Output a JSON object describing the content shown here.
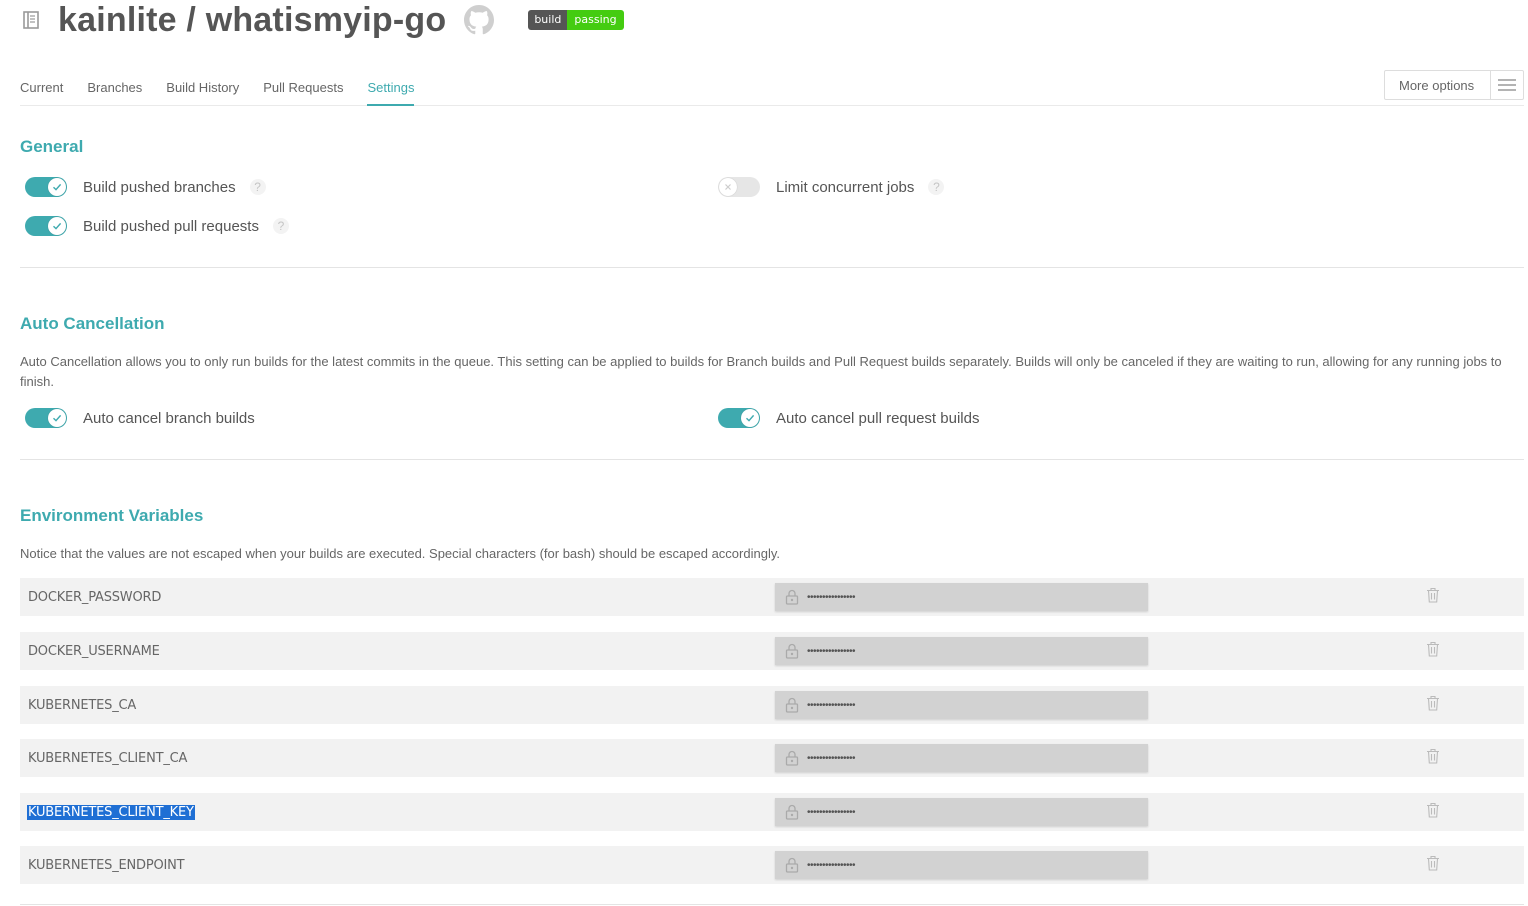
{
  "header": {
    "repo_title": "kainlite / whatismyip-go",
    "badge_left": "build",
    "badge_right": "passing",
    "repo_icon": "repo-book-icon",
    "github_icon": "github-octocat-icon"
  },
  "tabs": [
    {
      "label": "Current",
      "active": false
    },
    {
      "label": "Branches",
      "active": false
    },
    {
      "label": "Build History",
      "active": false
    },
    {
      "label": "Pull Requests",
      "active": false
    },
    {
      "label": "Settings",
      "active": true
    }
  ],
  "more_options": {
    "label": "More options",
    "icon": "hamburger-menu-icon"
  },
  "general": {
    "title": "General",
    "build_pushed_branches": {
      "label": "Build pushed branches",
      "enabled": true
    },
    "build_pushed_pull_requests": {
      "label": "Build pushed pull requests",
      "enabled": true
    },
    "limit_concurrent_jobs": {
      "label": "Limit concurrent jobs",
      "enabled": false
    },
    "help_glyph": "?"
  },
  "auto_cancellation": {
    "title": "Auto Cancellation",
    "description": "Auto Cancellation allows you to only run builds for the latest commits in the queue. This setting can be applied to builds for Branch builds and Pull Request builds separately. Builds will only be canceled if they are waiting to run, allowing for any running jobs to finish.",
    "auto_cancel_branch": {
      "label": "Auto cancel branch builds",
      "enabled": true
    },
    "auto_cancel_pr": {
      "label": "Auto cancel pull request builds",
      "enabled": true
    }
  },
  "environment_variables": {
    "title": "Environment Variables",
    "notice": "Notice that the values are not escaped when your builds are executed. Special characters (for bash) should be escaped accordingly.",
    "masked_value": "••••••••••••••••",
    "rows": [
      {
        "name": "DOCKER_PASSWORD"
      },
      {
        "name": "DOCKER_USERNAME"
      },
      {
        "name": "KUBERNETES_CA"
      },
      {
        "name": "KUBERNETES_CLIENT_CA"
      },
      {
        "name": "KUBERNETES_CLIENT_KEY",
        "selected": true
      },
      {
        "name": "KUBERNETES_ENDPOINT"
      }
    ]
  },
  "colors": {
    "accent": "#3eaaaf",
    "badge_green": "#44cc11",
    "badge_gray": "#555555"
  }
}
